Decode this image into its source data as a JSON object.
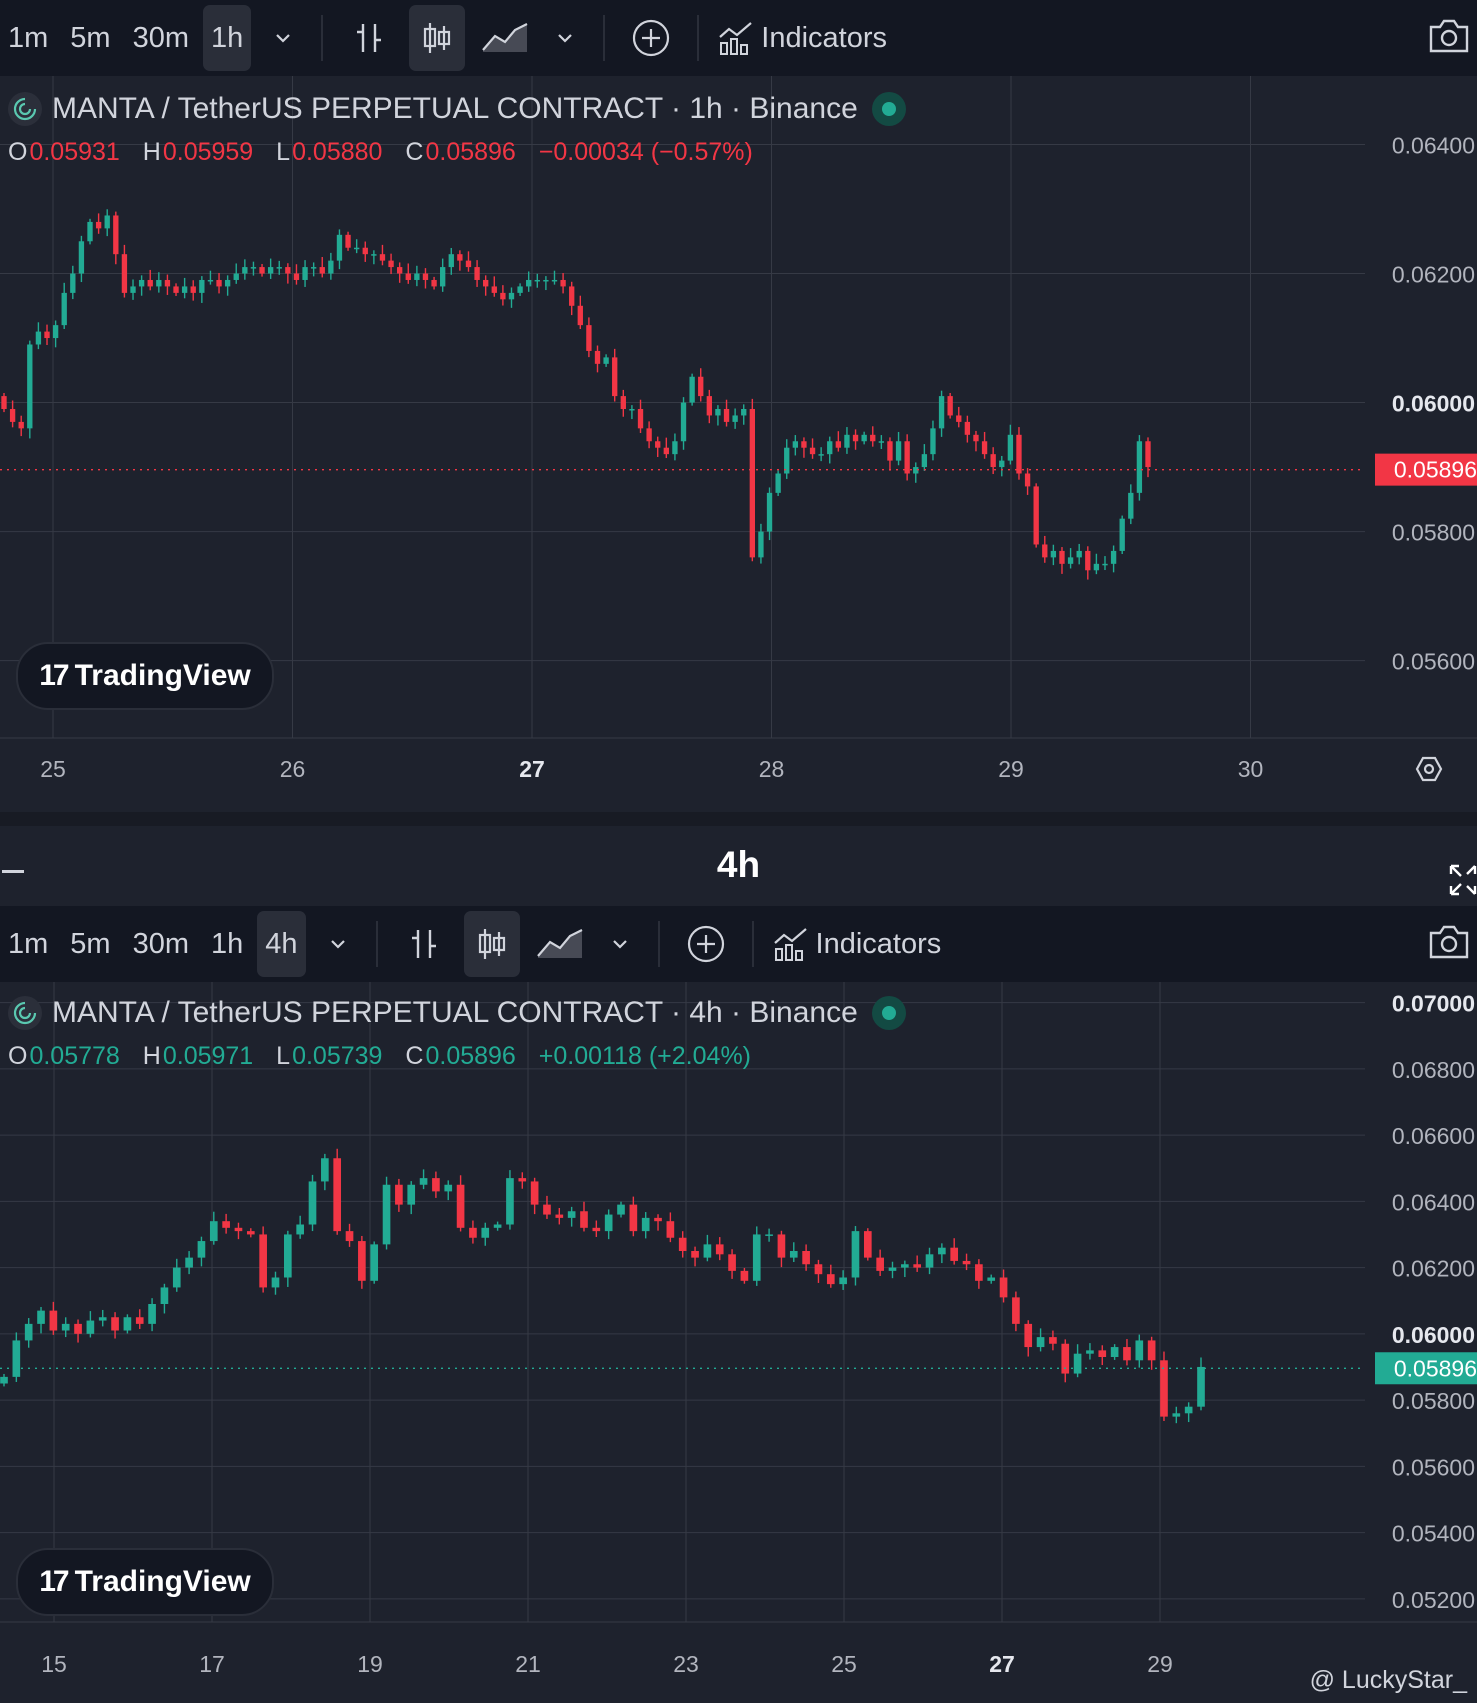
{
  "top": {
    "toolbar": {
      "timeframes": [
        "1m",
        "5m",
        "30m",
        "1h"
      ],
      "active_timeframe": "1h",
      "indicators_label": "Indicators"
    },
    "legend": {
      "title": "MANTA / TetherUS PERPETUAL CONTRACT · 1h · Binance",
      "o_key": "O",
      "o": "0.05931",
      "h_key": "H",
      "h": "0.05959",
      "l_key": "L",
      "l": "0.05880",
      "c_key": "C",
      "c": "0.05896",
      "change": "−0.00034 (−0.57%)",
      "color": "#f23645"
    },
    "tv_brand": "TradingView"
  },
  "divider": {
    "title": "4h"
  },
  "bottom": {
    "toolbar": {
      "timeframes": [
        "1m",
        "5m",
        "30m",
        "1h",
        "4h"
      ],
      "active_timeframe": "4h",
      "indicators_label": "Indicators"
    },
    "legend": {
      "title": "MANTA / TetherUS PERPETUAL CONTRACT · 4h · Binance",
      "o_key": "O",
      "o": "0.05778",
      "h_key": "H",
      "h": "0.05971",
      "l_key": "L",
      "l": "0.05739",
      "c_key": "C",
      "c": "0.05896",
      "change": "+0.00118 (+2.04%)",
      "color": "#22ab94"
    },
    "tv_brand": "TradingView"
  },
  "watermark": "@ LuckyStar_",
  "colors": {
    "up": "#22ab94",
    "down": "#f23645",
    "background": "#1e222d",
    "grid": "#363a45"
  },
  "chart_data": [
    {
      "type": "candlestick",
      "title": "MANTA / TetherUS PERPETUAL CONTRACT · 1h · Binance",
      "x_ticks": [
        "25",
        "26",
        "27",
        "28",
        "29",
        "30"
      ],
      "x_tick_bold": "27",
      "y_ticks": [
        "0.05600",
        "0.05800",
        "0.06000",
        "0.06200",
        "0.06400"
      ],
      "y_tick_bold": "0.06000",
      "ylim": [
        0.0548,
        0.065
      ],
      "last_price": "0.05896",
      "last_price_color": "#f23645",
      "closes": [
        0.0599,
        0.0597,
        0.0596,
        0.0609,
        0.0611,
        0.061,
        0.0612,
        0.0617,
        0.062,
        0.0625,
        0.0628,
        0.0627,
        0.0629,
        0.0623,
        0.0617,
        0.0618,
        0.0619,
        0.0618,
        0.0619,
        0.0618,
        0.0617,
        0.0618,
        0.0617,
        0.0619,
        0.0619,
        0.0618,
        0.0619,
        0.062,
        0.0621,
        0.0621,
        0.062,
        0.0621,
        0.0621,
        0.062,
        0.0619,
        0.0621,
        0.0621,
        0.062,
        0.0622,
        0.0626,
        0.0624,
        0.0624,
        0.0623,
        0.0623,
        0.0622,
        0.0621,
        0.062,
        0.0619,
        0.062,
        0.0619,
        0.0618,
        0.0621,
        0.0623,
        0.0622,
        0.0621,
        0.0619,
        0.0618,
        0.0617,
        0.0616,
        0.0617,
        0.0618,
        0.0619,
        0.0619,
        0.0619,
        0.0619,
        0.0618,
        0.0615,
        0.0612,
        0.0608,
        0.0606,
        0.0607,
        0.0601,
        0.0599,
        0.0599,
        0.0596,
        0.0594,
        0.0593,
        0.0592,
        0.0594,
        0.06,
        0.0604,
        0.0601,
        0.0598,
        0.0599,
        0.0597,
        0.0598,
        0.0599,
        0.0576,
        0.058,
        0.0586,
        0.0589,
        0.0593,
        0.0594,
        0.0593,
        0.0592,
        0.0592,
        0.0594,
        0.0593,
        0.0595,
        0.0594,
        0.0595,
        0.0594,
        0.0594,
        0.0591,
        0.0594,
        0.0589,
        0.059,
        0.0592,
        0.0596,
        0.0601,
        0.0598,
        0.0597,
        0.0595,
        0.0594,
        0.0592,
        0.059,
        0.0591,
        0.0595,
        0.0589,
        0.0587,
        0.0578,
        0.0576,
        0.0577,
        0.0575,
        0.0576,
        0.0577,
        0.0574,
        0.0575,
        0.0575,
        0.0577,
        0.0582,
        0.0586,
        0.0594,
        0.059
      ]
    },
    {
      "type": "candlestick",
      "title": "MANTA / TetherUS PERPETUAL CONTRACT · 4h · Binance",
      "x_ticks": [
        "15",
        "17",
        "19",
        "21",
        "23",
        "25",
        "27",
        "29"
      ],
      "x_tick_bold": "27",
      "y_ticks": [
        "0.05200",
        "0.05400",
        "0.05600",
        "0.05800",
        "0.06000",
        "0.06200",
        "0.06400",
        "0.06600",
        "0.06800",
        "0.07000"
      ],
      "y_tick_bold_list": [
        "0.06000",
        "0.07000"
      ],
      "ylim": [
        0.0513,
        0.0705
      ],
      "last_price": "0.05896",
      "last_price_color": "#22ab94",
      "closes": [
        0.0587,
        0.0598,
        0.0603,
        0.0607,
        0.0601,
        0.0603,
        0.06,
        0.0604,
        0.0605,
        0.0601,
        0.0605,
        0.0603,
        0.0609,
        0.0614,
        0.062,
        0.0623,
        0.0628,
        0.0634,
        0.0632,
        0.0631,
        0.063,
        0.0614,
        0.0617,
        0.063,
        0.0633,
        0.0646,
        0.0653,
        0.0631,
        0.0628,
        0.0616,
        0.0627,
        0.0645,
        0.0639,
        0.0645,
        0.0647,
        0.0643,
        0.0645,
        0.0632,
        0.0629,
        0.0632,
        0.0633,
        0.0647,
        0.0646,
        0.0639,
        0.0636,
        0.0635,
        0.0637,
        0.0632,
        0.0631,
        0.0636,
        0.0639,
        0.0631,
        0.0635,
        0.0634,
        0.0629,
        0.0625,
        0.0623,
        0.0627,
        0.0624,
        0.0619,
        0.0616,
        0.063,
        0.063,
        0.0623,
        0.0625,
        0.0621,
        0.0618,
        0.0615,
        0.0617,
        0.0631,
        0.0623,
        0.0619,
        0.062,
        0.0621,
        0.062,
        0.0624,
        0.0626,
        0.0622,
        0.0621,
        0.0616,
        0.0617,
        0.0611,
        0.0603,
        0.0596,
        0.0599,
        0.0597,
        0.0588,
        0.0594,
        0.0595,
        0.0593,
        0.0596,
        0.0592,
        0.0598,
        0.0592,
        0.0575,
        0.0576,
        0.0578,
        0.059
      ]
    }
  ]
}
